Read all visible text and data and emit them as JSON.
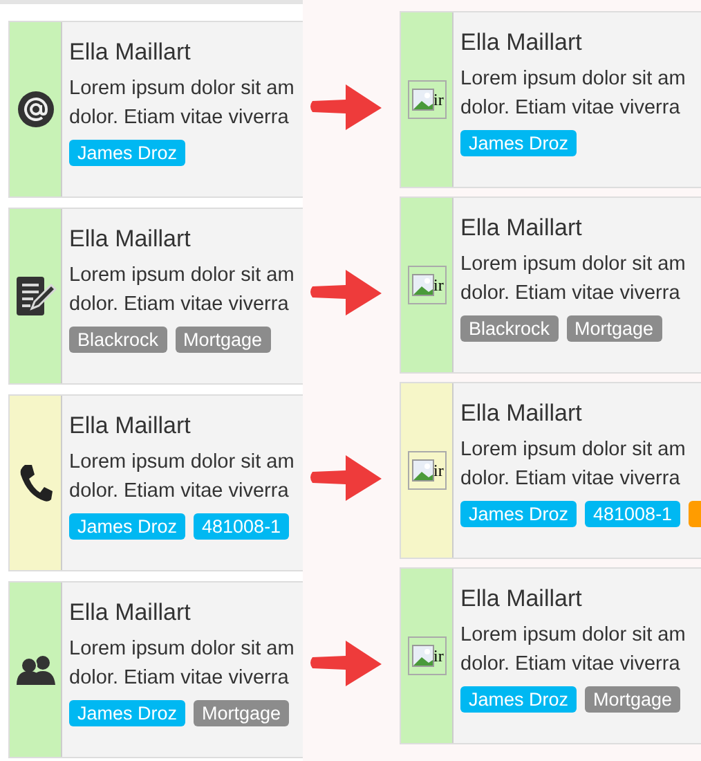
{
  "panels": [
    {
      "kind": "icons",
      "cards": [
        {
          "kind": "at",
          "color": "#c8f2b6",
          "title": "Ella Maillart",
          "lines": [
            "Lorem ipsum dolor sit am",
            "dolor. Etiam vitae viverra"
          ],
          "tags": [
            {
              "label": "James Droz",
              "color": "#00b8f2"
            }
          ]
        },
        {
          "kind": "edit",
          "color": "#c8f2b6",
          "title": "Ella Maillart",
          "lines": [
            "Lorem ipsum dolor sit am",
            "dolor. Etiam vitae viverra"
          ],
          "tags": [
            {
              "label": "Blackrock",
              "color": "#8c8c8c"
            },
            {
              "label": "Mortgage",
              "color": "#8c8c8c"
            }
          ]
        },
        {
          "kind": "phone",
          "color": "#f6f6c8",
          "title": "Ella Maillart",
          "lines": [
            "Lorem ipsum dolor sit am",
            "dolor. Etiam vitae viverra"
          ],
          "tags": [
            {
              "label": "James Droz",
              "color": "#00b8f2"
            },
            {
              "label": "481008-1",
              "color": "#00b8f2"
            }
          ]
        },
        {
          "kind": "people",
          "color": "#c8f2b6",
          "title": "Ella Maillart",
          "lines": [
            "Lorem ipsum dolor sit am",
            "dolor. Etiam vitae viverra"
          ],
          "tags": [
            {
              "label": "James Droz",
              "color": "#00b8f2"
            },
            {
              "label": "Mortgage",
              "color": "#8c8c8c"
            }
          ]
        }
      ]
    },
    {
      "kind": "broken_images",
      "cards": [
        {
          "alt": "ir",
          "color": "#c8f2b6",
          "title": "Ella Maillart",
          "lines": [
            "Lorem ipsum dolor sit am",
            "dolor. Etiam vitae viverra"
          ],
          "tags": [
            {
              "label": "James Droz",
              "color": "#00b8f2"
            }
          ]
        },
        {
          "alt": "ir",
          "color": "#c8f2b6",
          "title": "Ella Maillart",
          "lines": [
            "Lorem ipsum dolor sit am",
            "dolor. Etiam vitae viverra"
          ],
          "tags": [
            {
              "label": "Blackrock",
              "color": "#8c8c8c"
            },
            {
              "label": "Mortgage",
              "color": "#8c8c8c"
            }
          ]
        },
        {
          "alt": "ir",
          "color": "#f6f6c8",
          "title": "Ella Maillart",
          "lines": [
            "Lorem ipsum dolor sit am",
            "dolor. Etiam vitae viverra"
          ],
          "tags": [
            {
              "label": "James Droz",
              "color": "#00b8f2"
            },
            {
              "label": "481008-1",
              "color": "#00b8f2"
            },
            {
              "color": "#ff9c00"
            }
          ]
        },
        {
          "alt": "ir",
          "color": "#c8f2b6",
          "title": "Ella Maillart",
          "lines": [
            "Lorem ipsum dolor sit am",
            "dolor. Etiam vitae viverra"
          ],
          "tags": [
            {
              "label": "James Droz",
              "color": "#00b8f2"
            },
            {
              "label": "Mortgage",
              "color": "#8c8c8c"
            }
          ]
        }
      ]
    }
  ]
}
